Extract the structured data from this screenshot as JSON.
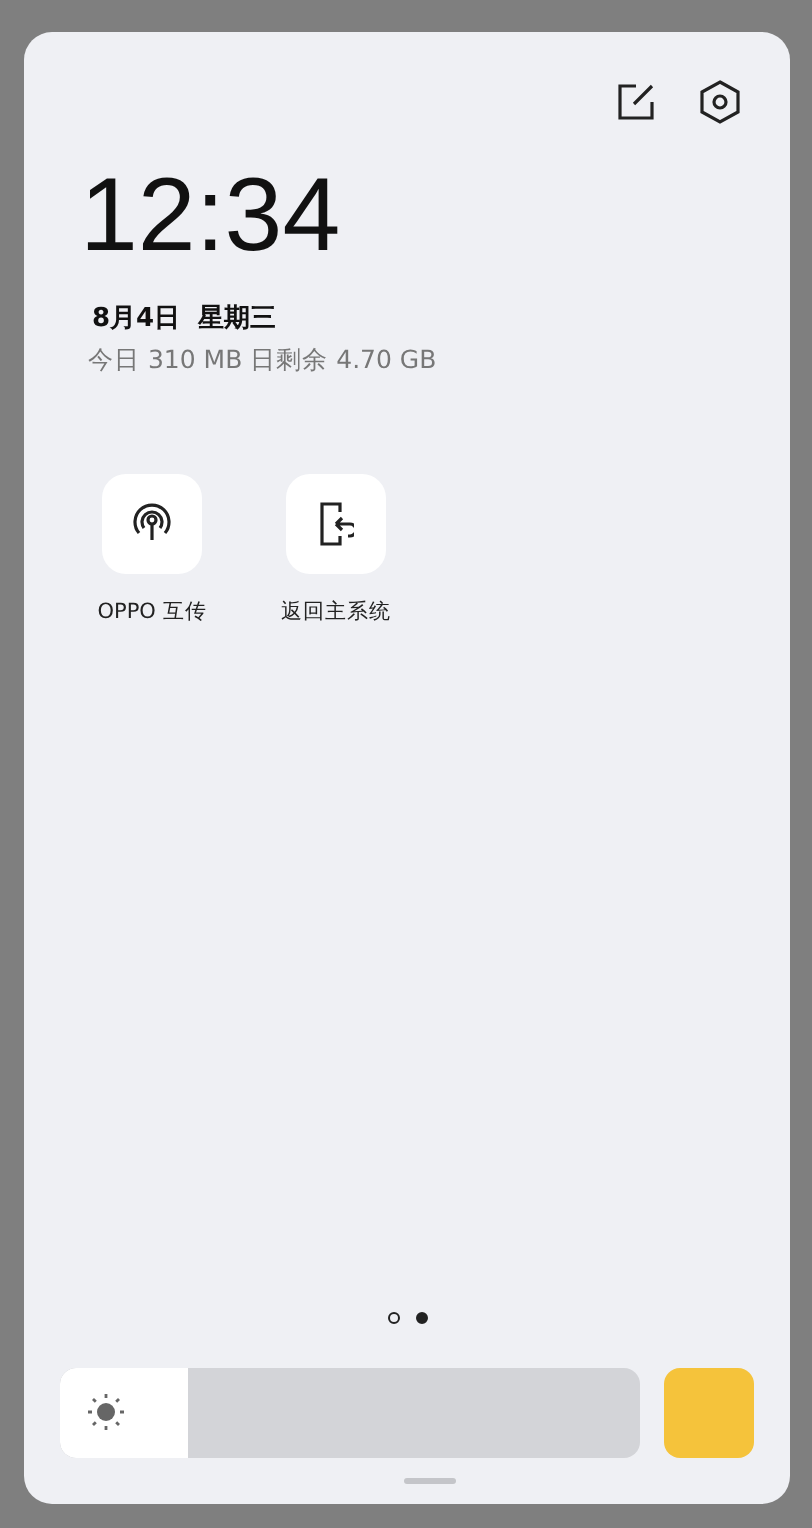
{
  "clock": {
    "time": "12:34",
    "date": "8月4日  星期三",
    "data_usage": "今日 310 MB 日剩余 4.70 GB"
  },
  "shortcuts": [
    {
      "kind": "cast",
      "label": "OPPO 互传"
    },
    {
      "kind": "exit",
      "label": "返回主系统"
    }
  ],
  "pages": [
    {
      "selected": false
    },
    {
      "selected": true
    }
  ],
  "brightness": {
    "level": 0.22
  }
}
